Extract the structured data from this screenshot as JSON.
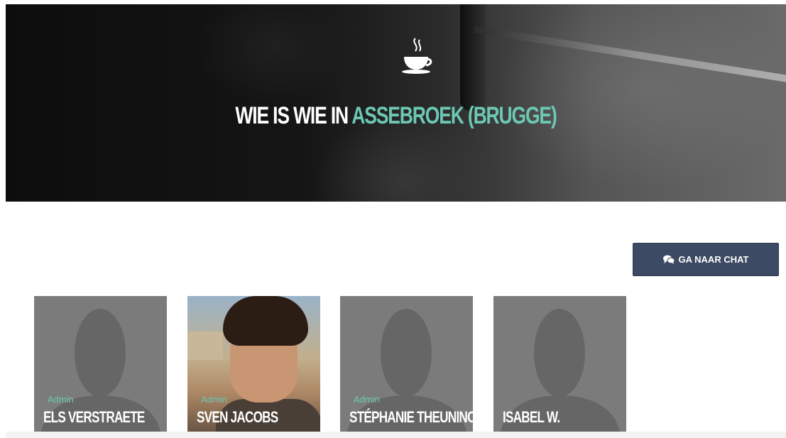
{
  "hero": {
    "title_prefix": "WIE IS WIE IN ",
    "title_accent": "ASSEBROEK (BRUGGE)",
    "icon": "coffee-cup-icon"
  },
  "actions": {
    "chat_label": "GA NAAR CHAT",
    "chat_icon": "chat-bubbles-icon"
  },
  "members": [
    {
      "role": "Admin",
      "name": "ELS VERSTRAETE"
    },
    {
      "role": "Admin",
      "name": "SVEN JACOBS"
    },
    {
      "role": "Admin",
      "name": "STÉPHANIE THEUNINCK"
    },
    {
      "role": "",
      "name": "ISABEL W."
    }
  ],
  "colors": {
    "accent": "#6cc8b3",
    "button": "#3c4a63",
    "card_placeholder": "#7b7b7b"
  }
}
